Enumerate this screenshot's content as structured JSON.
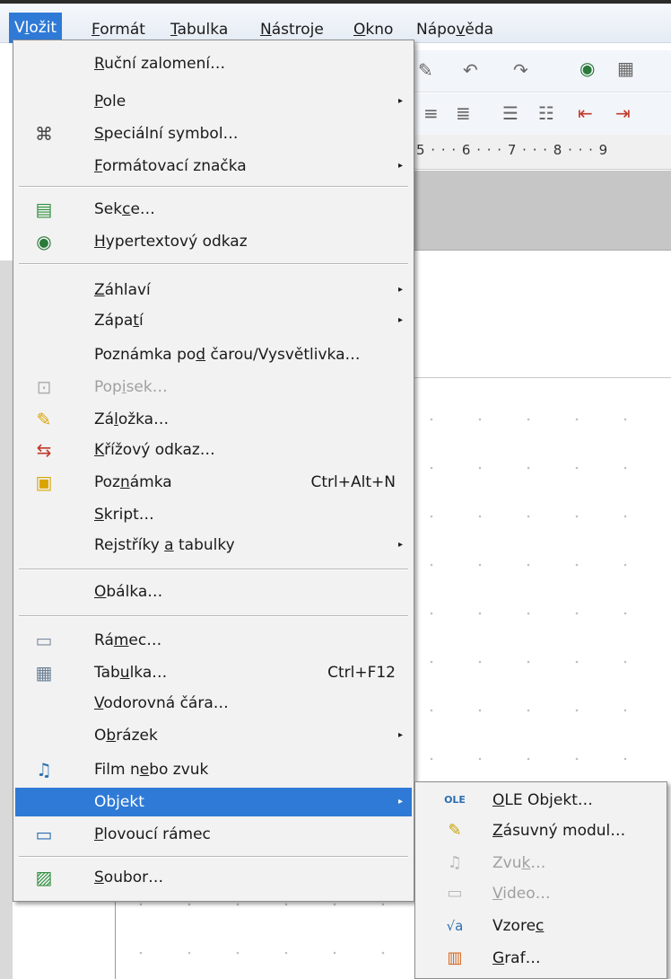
{
  "menubar": {
    "items": [
      {
        "pre": "V",
        "u": "l",
        "post": "ožit"
      },
      {
        "pre": "",
        "u": "F",
        "post": "ormát"
      },
      {
        "pre": "",
        "u": "T",
        "post": "abulka"
      },
      {
        "pre": "",
        "u": "N",
        "post": "ástroje"
      },
      {
        "pre": "",
        "u": "O",
        "post": "kno"
      },
      {
        "pre": "Nápo",
        "u": "v",
        "post": "ěda"
      }
    ]
  },
  "ruler": {
    "text": "5 · · · 6 · · · 7 · · · 8 · · · 9"
  },
  "menu": {
    "items": [
      {
        "pre": "",
        "u": "R",
        "post": "uční zalomení…",
        "shortcut": "",
        "arrow": ""
      },
      {
        "pre": "",
        "u": "P",
        "post": "ole",
        "shortcut": "",
        "arrow": "▸"
      },
      {
        "pre": "",
        "u": "S",
        "post": "peciální symbol…",
        "shortcut": "",
        "arrow": ""
      },
      {
        "pre": "",
        "u": "F",
        "post": "ormátovací značka",
        "shortcut": "",
        "arrow": "▸"
      },
      {
        "pre": "Sek",
        "u": "c",
        "post": "e…",
        "shortcut": "",
        "arrow": ""
      },
      {
        "pre": "",
        "u": "H",
        "post": "ypertextový odkaz",
        "shortcut": "",
        "arrow": ""
      },
      {
        "pre": "",
        "u": "Z",
        "post": "áhlaví",
        "shortcut": "",
        "arrow": "▸"
      },
      {
        "pre": "Zápa",
        "u": "t",
        "post": "í",
        "shortcut": "",
        "arrow": "▸"
      },
      {
        "pre": "Poznámka po",
        "u": "d",
        "post": " čarou/Vysvětlivka…",
        "shortcut": "",
        "arrow": ""
      },
      {
        "pre": "Pop",
        "u": "i",
        "post": "sek…",
        "shortcut": "",
        "arrow": ""
      },
      {
        "pre": "Zá",
        "u": "l",
        "post": "ožka…",
        "shortcut": "",
        "arrow": ""
      },
      {
        "pre": "",
        "u": "K",
        "post": "řížový odkaz…",
        "shortcut": "",
        "arrow": ""
      },
      {
        "pre": "Poz",
        "u": "n",
        "post": "ámka",
        "shortcut": "Ctrl+Alt+N",
        "arrow": ""
      },
      {
        "pre": "",
        "u": "S",
        "post": "kript…",
        "shortcut": "",
        "arrow": ""
      },
      {
        "pre": "Rejstříky ",
        "u": "a",
        "post": " tabulky",
        "shortcut": "",
        "arrow": "▸"
      },
      {
        "pre": "",
        "u": "O",
        "post": "bálka…",
        "shortcut": "",
        "arrow": ""
      },
      {
        "pre": "Rá",
        "u": "m",
        "post": "ec…",
        "shortcut": "",
        "arrow": ""
      },
      {
        "pre": "Tab",
        "u": "u",
        "post": "lka…",
        "shortcut": "Ctrl+F12",
        "arrow": ""
      },
      {
        "pre": "",
        "u": "V",
        "post": "odorovná čára…",
        "shortcut": "",
        "arrow": ""
      },
      {
        "pre": "O",
        "u": "b",
        "post": "rázek",
        "shortcut": "",
        "arrow": "▸"
      },
      {
        "pre": "Film n",
        "u": "e",
        "post": "bo zvuk",
        "shortcut": "",
        "arrow": ""
      },
      {
        "pre": "",
        "u": "",
        "post": "Objekt",
        "shortcut": "",
        "arrow": "▸"
      },
      {
        "pre": "",
        "u": "P",
        "post": "lovoucí rámec",
        "shortcut": "",
        "arrow": ""
      },
      {
        "pre": "",
        "u": "S",
        "post": "oubor…",
        "shortcut": "",
        "arrow": ""
      }
    ]
  },
  "submenu": {
    "items": [
      {
        "pre": "",
        "u": "O",
        "post": "LE Objekt…"
      },
      {
        "pre": "",
        "u": "Z",
        "post": "ásuvný modul…"
      },
      {
        "pre": "Zvu",
        "u": "k",
        "post": "…"
      },
      {
        "pre": "",
        "u": "V",
        "post": "ideo…"
      },
      {
        "pre": "Vzore",
        "u": "c",
        "post": ""
      },
      {
        "pre": "",
        "u": "G",
        "post": "raf…"
      }
    ]
  }
}
